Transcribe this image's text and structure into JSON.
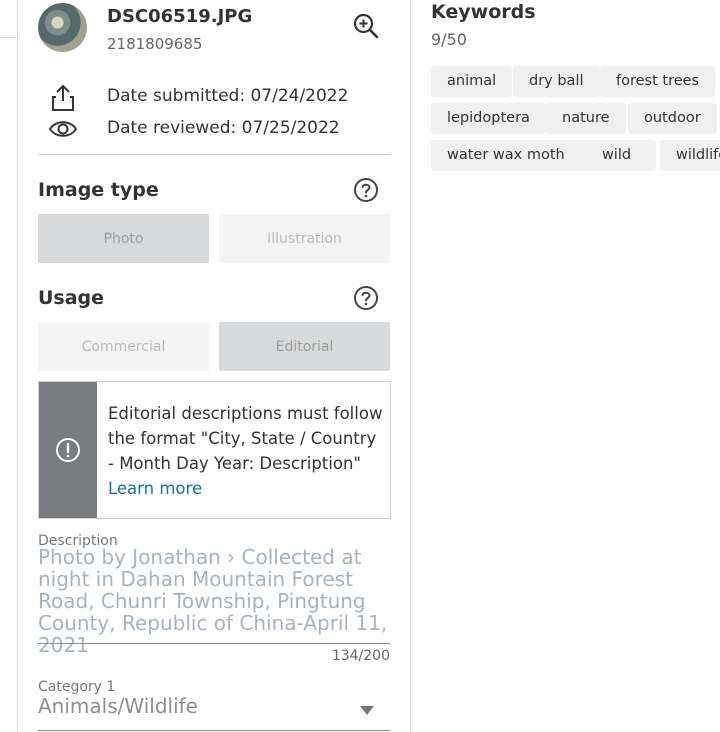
{
  "file": {
    "name": "DSC06519.JPG",
    "id": "2181809685"
  },
  "meta": {
    "submitted": "Date submitted: 07/24/2022",
    "reviewed": "Date reviewed: 07/25/2022"
  },
  "image_type": {
    "title": "Image type",
    "options": [
      "Photo",
      "Illustration"
    ],
    "selected": "Photo"
  },
  "usage": {
    "title": "Usage",
    "options": [
      "Commercial",
      "Editorial"
    ],
    "selected": "Editorial"
  },
  "notice": {
    "text": "Editorial descriptions must follow the format \"City, State / Country - Month Day Year: Description\"",
    "link": "Learn more"
  },
  "description": {
    "label": "Description",
    "value": "Photo by Jonathan › Collected at night in Dahan Mountain Forest Road, Chunri Township, Pingtung County, Republic of China-April 11, 2021",
    "counter": "134/200"
  },
  "category1": {
    "label": "Category 1",
    "value": "Animals/Wildlife"
  },
  "keywords": {
    "title": "Keywords",
    "count": "9/50",
    "items": [
      "animal",
      "dry ball",
      "forest trees",
      "lepidoptera",
      "nature",
      "outdoor",
      "water wax moth",
      "wild",
      "wildlife"
    ]
  },
  "icons": {
    "zoom": "zoom-in-icon",
    "share": "share-icon",
    "view": "eye-icon",
    "help": "question-circle-icon",
    "alert": "exclamation-circle-icon",
    "dropdown": "caret-down-icon"
  },
  "colors": {
    "selected_toggle": "#d8d9da",
    "unselected_toggle": "#f4f4f4",
    "notice_bar": "#7a7c80",
    "link": "#1a6fa8",
    "chip_bg": "#f0f0f0"
  }
}
